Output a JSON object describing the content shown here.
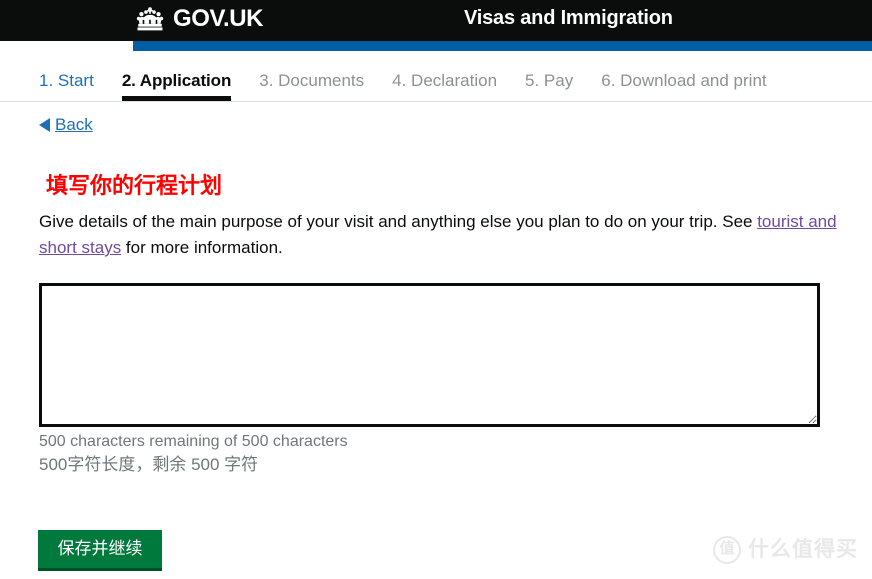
{
  "masthead": {
    "brand_name": "GOV.UK",
    "crown_icon": "crown-icon",
    "service_title": "Visas and Immigration",
    "bar_color": "#005ea5",
    "background_color": "#0b0c0c"
  },
  "step_nav": {
    "steps": [
      {
        "label": "1. Start",
        "state": "done"
      },
      {
        "label": "2. Application",
        "state": "current"
      },
      {
        "label": "3. Documents",
        "state": "upcoming"
      },
      {
        "label": "4. Declaration",
        "state": "upcoming"
      },
      {
        "label": "5. Pay",
        "state": "upcoming"
      },
      {
        "label": "6. Download and print",
        "state": "upcoming"
      }
    ]
  },
  "back": {
    "label": "Back",
    "arrow_icon": "triangle-left-icon"
  },
  "content": {
    "heading": "填写你的行程计划",
    "heading_color": "#ff0000",
    "lede_part1": "Give details of the main purpose of your visit and anything else you plan to do on your trip. See ",
    "lede_link": "tourist and short stays",
    "lede_part2": " for more information.",
    "link_color": "#6f4b9e"
  },
  "answer": {
    "value": "",
    "placeholder": ""
  },
  "counter": {
    "english": "500 characters remaining of 500 characters",
    "chinese": "500字符长度，剩余 500 字符"
  },
  "submit": {
    "label": "保存并继续",
    "color": "#00793c"
  },
  "watermark": {
    "badge": "值",
    "text": "什么值得买"
  }
}
